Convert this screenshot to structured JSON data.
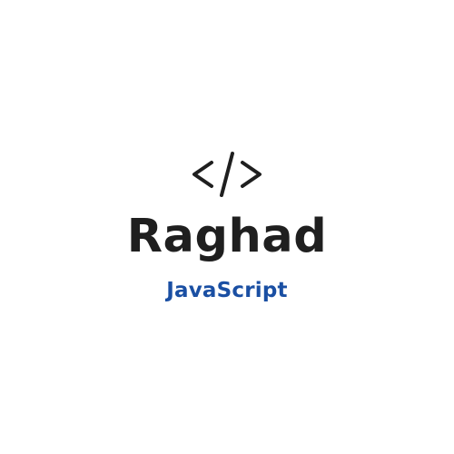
{
  "logo": {
    "icon": "code-brackets-icon",
    "name": "Raghad",
    "tagline": "JavaScript",
    "colors": {
      "primary": "#1f1f1f",
      "accent": "#1a4fa3",
      "background": "#ffffff"
    }
  }
}
